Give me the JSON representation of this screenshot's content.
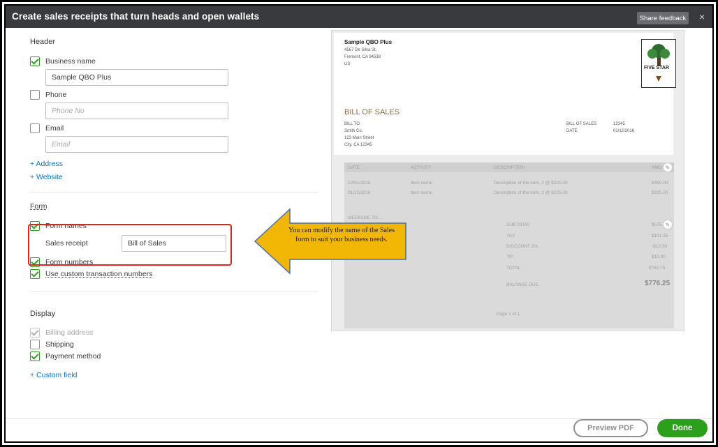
{
  "window": {
    "title": "Create sales receipts that turn heads and open wallets",
    "share_label": "Share feedback",
    "close_glyph": "×"
  },
  "header_section": {
    "title": "Header",
    "business_name": {
      "label": "Business name",
      "checked": true,
      "value": "Sample QBO Plus"
    },
    "phone": {
      "label": "Phone",
      "checked": false,
      "placeholder": "Phone No"
    },
    "email": {
      "label": "Email",
      "checked": false,
      "placeholder": "Email"
    },
    "add_address": "+ Address",
    "add_website": "+ Website"
  },
  "form_section": {
    "title": "Form",
    "form_names": {
      "label": "Form names",
      "checked": true,
      "sub_label": "Sales receipt",
      "value": "Bill of Sales"
    },
    "form_numbers": {
      "label": "Form numbers",
      "checked": true
    },
    "custom_numbers": {
      "label": "Use custom transaction numbers",
      "checked": true
    }
  },
  "display_section": {
    "title": "Display",
    "billing_address": {
      "label": "Billing address",
      "checked": true,
      "disabled": true
    },
    "shipping": {
      "label": "Shipping",
      "checked": false
    },
    "payment_method": {
      "label": "Payment method",
      "checked": true
    },
    "custom_field": "+ Custom field"
  },
  "callout": {
    "text": "You can modify the name of the Sales form to suit your business needs.",
    "color": "#f2b705"
  },
  "preview": {
    "company": "Sample QBO Plus",
    "address_lines": [
      "4567 De Silva St.",
      "Fremont, CA 94538",
      "US"
    ],
    "logo_text": "FIVE STAR",
    "doc_title": "BILL OF SALES",
    "bill_to_label": "BILL TO",
    "bill_to_lines": [
      "Smith Co.",
      "123 Main Street",
      "City, CA 12345"
    ],
    "meta": [
      {
        "label": "BILL OF SALES",
        "value": "12345"
      },
      {
        "label": "DATE",
        "value": "01/12/2016"
      }
    ],
    "columns": [
      "DATE",
      "ACTIVITY",
      "DESCRIPTION",
      "AMO"
    ],
    "rows": [
      {
        "date": "12/01/2016",
        "activity": "Item name",
        "description": "Description of the item, 2 @ $225.00",
        "amount": "$450.00"
      },
      {
        "date": "01/12/2016",
        "activity": "Item name",
        "description": "Description of the item, 2 @ $225.00",
        "amount": "$225.00"
      }
    ],
    "message_label": "MESSAGE TO ...",
    "summary": [
      {
        "label": "SUBTOTAL",
        "value": "$675"
      },
      {
        "label": "TAX",
        "value": "$101.25"
      },
      {
        "label": "DISCOUNT 2%",
        "value": "-$13.50"
      },
      {
        "label": "TIP",
        "value": "$10.00"
      },
      {
        "label": "TOTAL",
        "value": "$782.75"
      }
    ],
    "balance_label": "BALANCE DUE",
    "balance_value": "$776.25",
    "page_label": "Page 1 of 1"
  },
  "footer": {
    "preview_label": "Preview PDF",
    "done_label": "Done"
  }
}
